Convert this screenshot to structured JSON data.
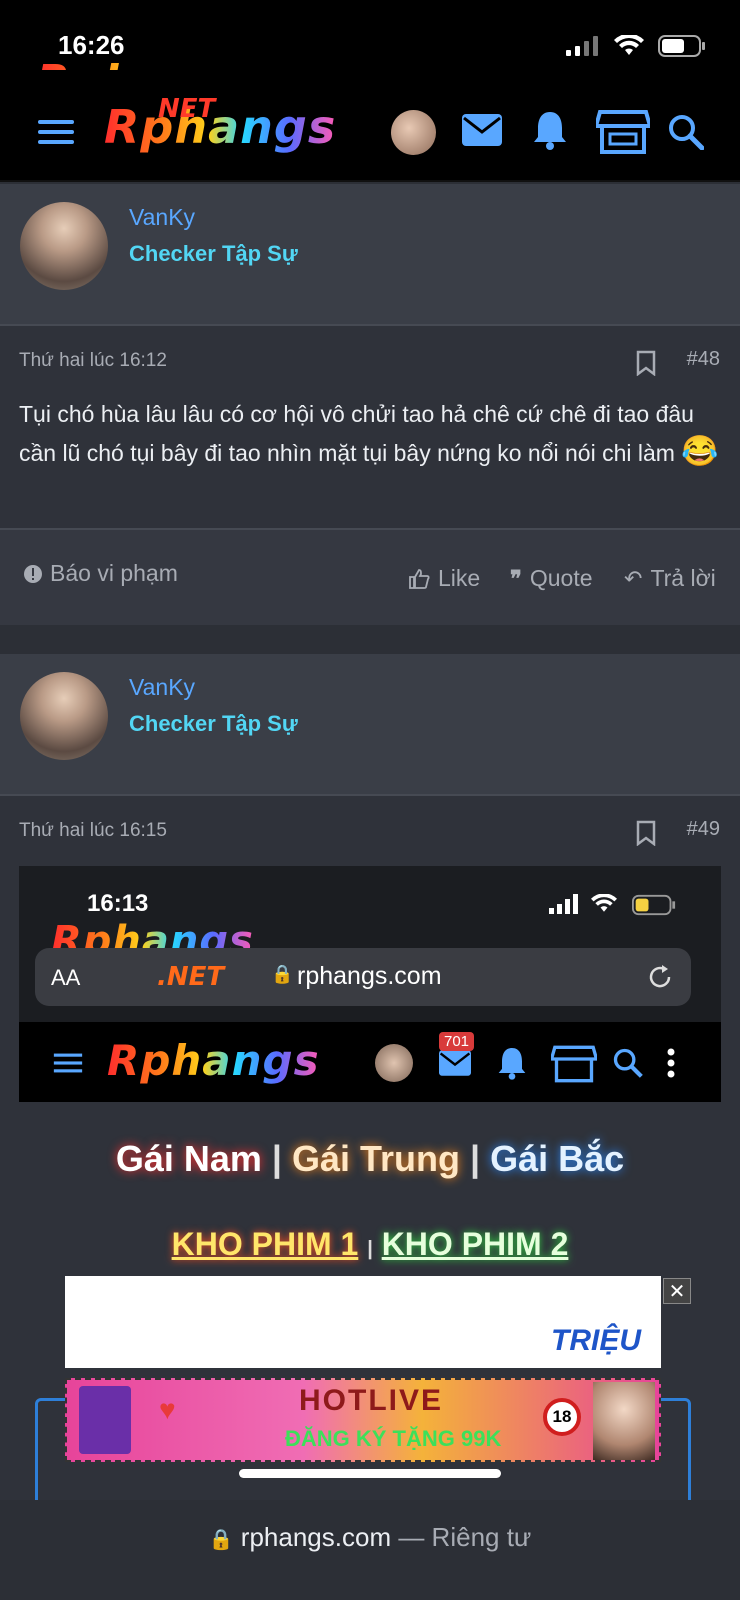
{
  "status": {
    "time": "16:26"
  },
  "header": {
    "logo_top": "Rphangs",
    "logo_net": "NET",
    "logo_main": "Rphangs"
  },
  "posts": [
    {
      "username": "VanKy",
      "user_title": "Checker Tập Sự",
      "time": "Thứ hai lúc 16:12",
      "number": "#48",
      "message": "Tụi chó hùa lâu lâu có cơ hội vô chửi tao hả chê cứ chê đi tao đâu cần lũ chó tụi bây đi tao nhìn mặt tụi bây nứng ko nổi nói chi làm",
      "emoji": "😂",
      "actions": {
        "report": "Báo vi phạm",
        "like": "Like",
        "quote": "Quote",
        "reply": "Trả lời"
      }
    },
    {
      "username": "VanKy",
      "user_title": "Checker Tập Sự",
      "time": "Thứ hai lúc 16:15",
      "number": "#49"
    }
  ],
  "embedded_screenshot": {
    "time": "16:13",
    "logo": "Rphangs",
    "logo_net": ".NET",
    "aa": "AA",
    "url": "rphangs.com",
    "badge": "701",
    "site_logo": "Rphangs",
    "links": [
      "Gái Nam",
      "Gái Trung",
      "Gái Bắc"
    ],
    "sep": "|",
    "kho": [
      "KHO PHIM 1",
      "KHO PHIM 2"
    ],
    "ad_trieu": "TRIỆU",
    "ad_hotlive": "HOTLIVE",
    "ad_sub": "ĐĂNG KÝ TẶNG 99K",
    "ad_18": "18",
    "ad_close": "✕"
  },
  "bottom": {
    "url": "rphangs.com",
    "suffix": " — Riêng tư"
  },
  "colors": {
    "accent_blue": "#59a7ff",
    "title_cyan": "#52d6f4",
    "bg": "#2c2f36"
  }
}
